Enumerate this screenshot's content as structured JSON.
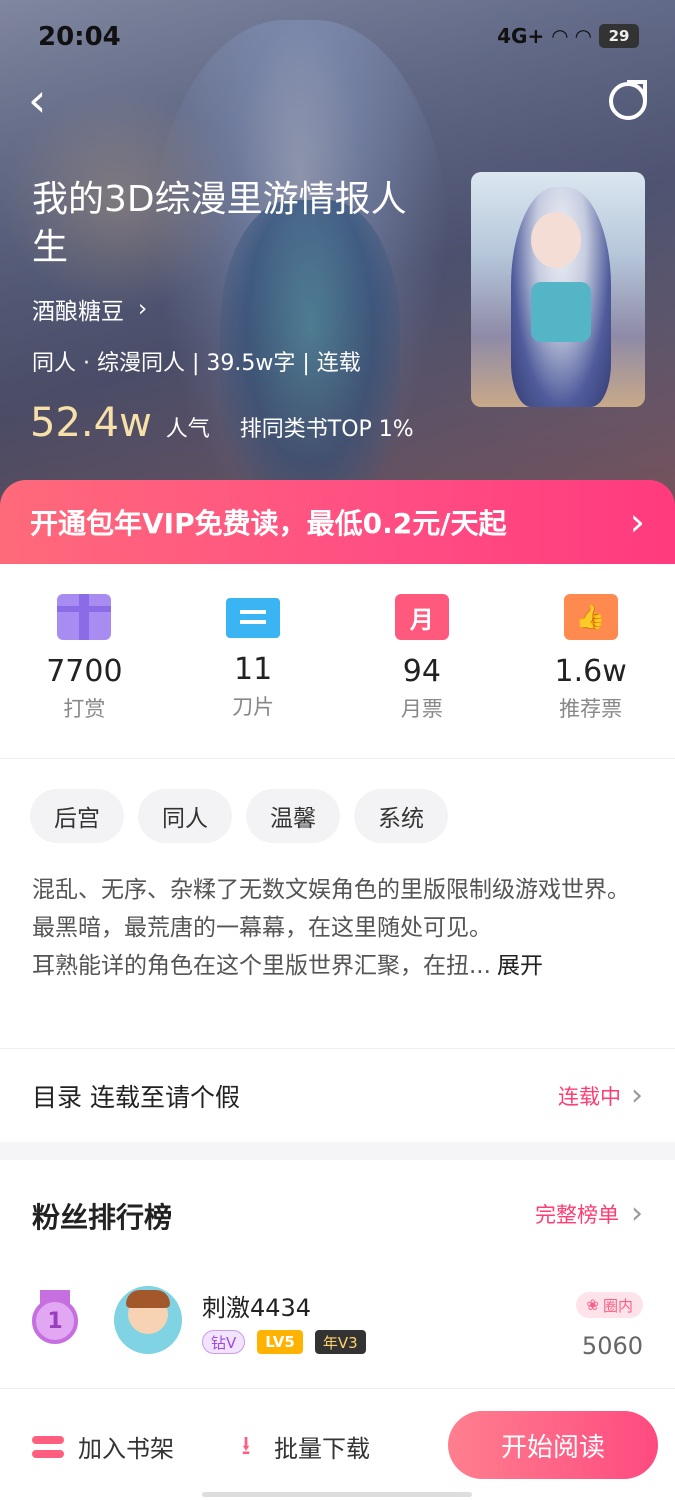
{
  "status_bar": {
    "time": "20:04",
    "network": "4G+",
    "battery": "29"
  },
  "book": {
    "title": "我的3D综漫里游情报人生",
    "author": "酒酿糖豆",
    "meta": "同人 · 综漫同人 | 39.5w字 | 连载",
    "popularity": "52.4w",
    "popularity_label": "人气",
    "rank": "排同类书TOP 1%"
  },
  "vip_banner": {
    "text": "开通包年VIP免费读，最低0.2元/天起"
  },
  "stats": [
    {
      "icon": "gift-icon",
      "value": "7700",
      "label": "打赏"
    },
    {
      "icon": "blade-ticket-icon",
      "value": "11",
      "label": "刀片"
    },
    {
      "icon": "month-ticket-icon",
      "value": "94",
      "label": "月票"
    },
    {
      "icon": "thumbs-up-ticket-icon",
      "value": "1.6w",
      "label": "推荐票"
    }
  ],
  "tags": [
    "后宫",
    "同人",
    "温馨",
    "系统"
  ],
  "intro": {
    "line1": "混乱、无序、杂糅了无数文娱角色的里版限制级游戏世界。",
    "line2": "最黑暗，最荒唐的一幕幕，在这里随处可见。",
    "line3": "耳熟能详的角色在这个里版世界汇聚，在扭...",
    "expand": "展开"
  },
  "catalog": {
    "title": "目录 连载至请个假",
    "status": "连载中"
  },
  "fans": {
    "title": "粉丝排行榜",
    "full_list": "完整榜单",
    "top": {
      "rank": "1",
      "name": "刺激4434",
      "badge_diamond": "钻V",
      "badge_lv": "LV5",
      "badge_year": "年V3",
      "circle": "圈内",
      "score": "5060"
    }
  },
  "bottom_bar": {
    "shelf": "加入书架",
    "download": "批量下载",
    "read": "开始阅读"
  },
  "colors": {
    "accent": "#ff4a80",
    "popularity": "#f7e1a8"
  }
}
